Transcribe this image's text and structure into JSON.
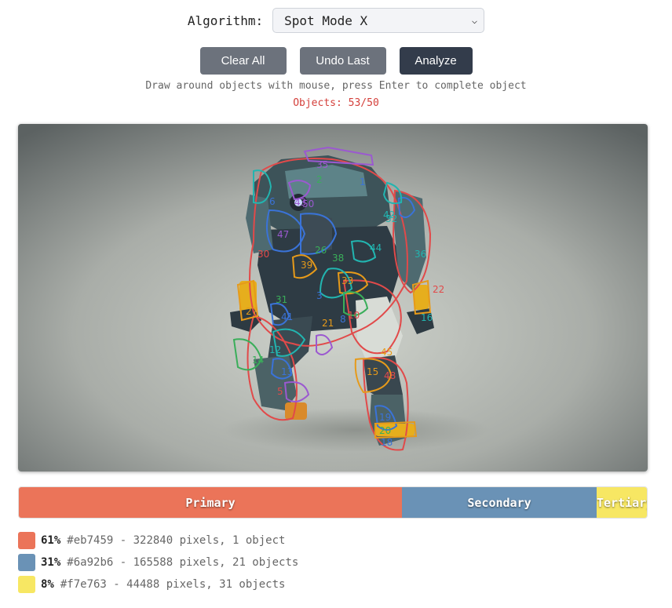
{
  "algorithm": {
    "label": "Algorithm:",
    "selected": "Spot Mode X"
  },
  "buttons": {
    "clear": "Clear All",
    "undo": "Undo Last",
    "analyze": "Analyze"
  },
  "hint": "Draw around objects with mouse, press Enter to complete object",
  "objects_count": "Objects: 53/50",
  "canvas": {
    "object_labels": [
      "1",
      "2",
      "3",
      "5",
      "6",
      "8",
      "10",
      "12",
      "13",
      "14",
      "15",
      "16",
      "18",
      "19",
      "20",
      "21",
      "22",
      "26",
      "27",
      "30",
      "31",
      "32",
      "33",
      "35",
      "36",
      "38",
      "39",
      "41",
      "42",
      "43",
      "44",
      "45",
      "47",
      "48",
      "50"
    ]
  },
  "palette": {
    "bar": [
      {
        "label": "Primary",
        "color": "#eb7459",
        "fraction": 0.61
      },
      {
        "label": "Secondary",
        "color": "#6a92b6",
        "fraction": 0.31
      },
      {
        "label": "Tertiary",
        "color": "#f7e763",
        "fraction": 0.08
      }
    ],
    "legend": [
      {
        "percent": "61%",
        "detail": "#eb7459 - 322840 pixels, 1 object",
        "color": "#eb7459"
      },
      {
        "percent": "31%",
        "detail": "#6a92b6 - 165588 pixels, 21 objects",
        "color": "#6a92b6"
      },
      {
        "percent": "8%",
        "detail": "#f7e763 - 44488 pixels, 31 objects",
        "color": "#f7e763"
      }
    ]
  }
}
